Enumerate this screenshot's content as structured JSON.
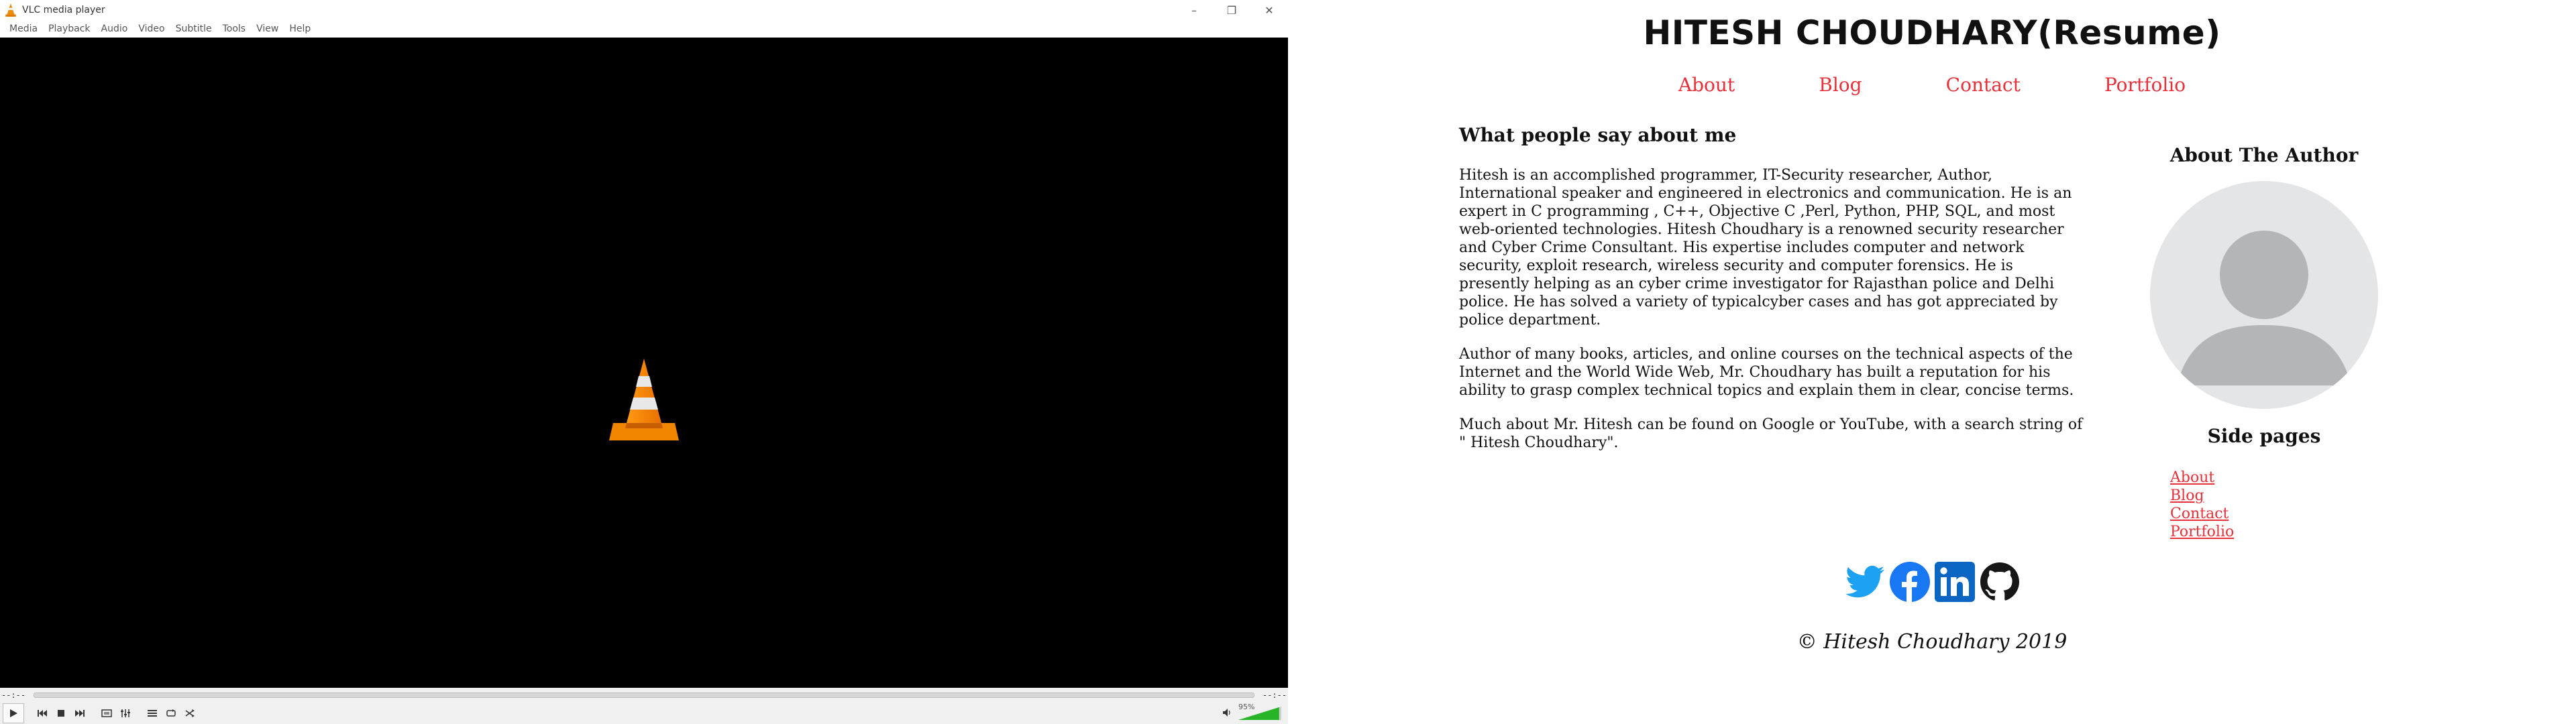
{
  "vlc": {
    "title": "VLC media player",
    "menu": [
      "Media",
      "Playback",
      "Audio",
      "Video",
      "Subtitle",
      "Tools",
      "View",
      "Help"
    ],
    "time_elapsed": "--:--",
    "time_total": "--:--",
    "volume_percent": "95%",
    "volume_level": 0.95,
    "icons": [
      "vlc-cone-icon",
      "play-icon",
      "previous-icon",
      "stop-icon",
      "next-icon",
      "fullscreen-icon",
      "extended-settings-icon",
      "playlist-icon",
      "loop-icon",
      "shuffle-icon",
      "speaker-icon"
    ]
  },
  "page": {
    "site_title": "HITESH CHOUDHARY(Resume)",
    "nav": [
      "About",
      "Blog",
      "Contact",
      "Portfolio"
    ],
    "heading": "What people say about me",
    "paragraphs": [
      "Hitesh is an accomplished programmer, IT-Security researcher, Author, International speaker and engineered in electronics and communication. He is an expert in C programming , C++, Objective C ,Perl, Python, PHP, SQL, and most web-oriented technologies. Hitesh Choudhary is a renowned security researcher and Cyber Crime Consultant. His expertise includes computer and network security, exploit research, wireless security and computer forensics. He is presently helping as an cyber crime investigator for Rajasthan police and Delhi police. He has solved a variety of typicalcyber cases and has got appreciated by police department.",
      "Author of many books, articles, and online courses on the technical aspects of the Internet and the World Wide Web, Mr. Choudhary has built a reputation for his ability to grasp complex technical topics and explain them in clear, concise terms.",
      "Much about Mr. Hitesh can be found on Google or YouTube, with a search string of \" Hitesh Choudhary\"."
    ],
    "about_author_title": "About The Author",
    "side_pages_title": "Side pages",
    "side_pages": [
      "About",
      "Blog",
      "Contact",
      "Portfolio"
    ],
    "social_icons": [
      "twitter-icon",
      "facebook-icon",
      "linkedin-icon",
      "github-icon"
    ],
    "footer": "© Hitesh Choudhary 2019",
    "colors": {
      "link": "#e8313a",
      "twitter": "#1da1f2",
      "facebook": "#1877f2",
      "linkedin": "#0a66c2"
    }
  }
}
